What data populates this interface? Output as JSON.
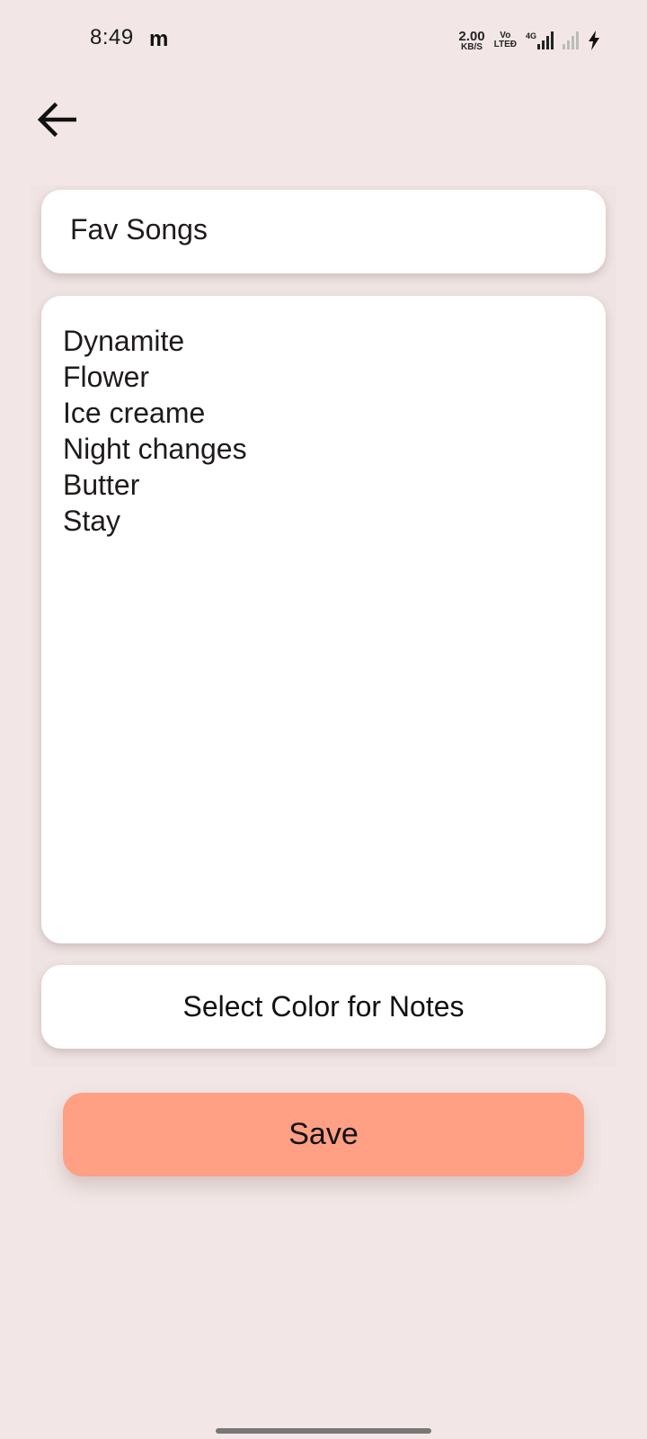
{
  "status_bar": {
    "time": "8:49",
    "app_icon": "m",
    "net_speed_value": "2.00",
    "net_speed_unit": "KB/S",
    "volte_top": "Vo",
    "volte_bottom": "LTEĐ",
    "network_type": "4G"
  },
  "note": {
    "title": "Fav Songs",
    "body_lines": [
      "Dynamite",
      "Flower",
      "Ice creame",
      "Night changes",
      "Butter",
      "Stay"
    ]
  },
  "actions": {
    "select_color_label": "Select Color for Notes",
    "save_label": "Save"
  },
  "colors": {
    "background": "#f2e7e6",
    "save_button": "#ff9f84",
    "field_background": "#ffffff"
  },
  "icons": {
    "back": "arrow-left-icon",
    "charging": "bolt-icon"
  }
}
